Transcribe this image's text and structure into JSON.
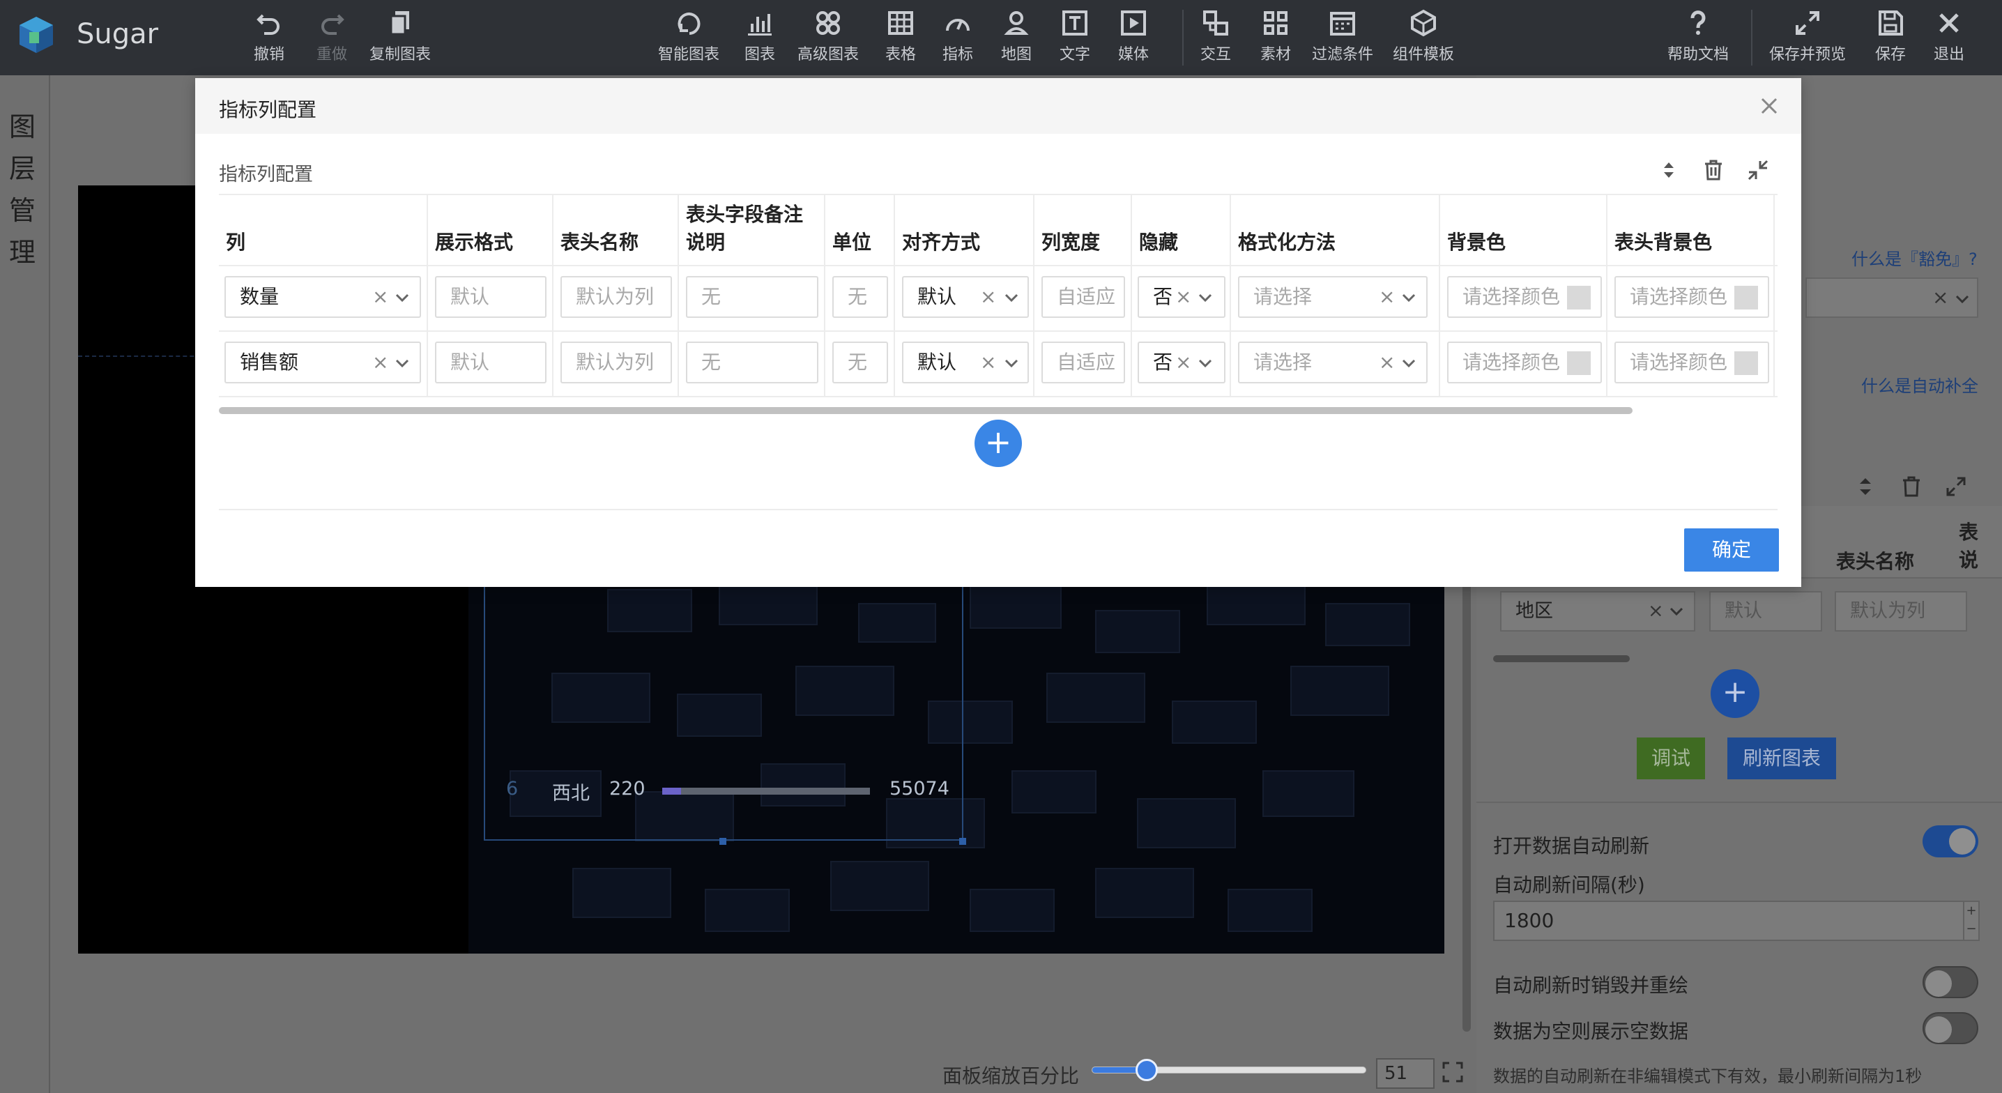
{
  "app": {
    "name": "Sugar"
  },
  "toolbar": {
    "undo": "撤销",
    "redo": "重做",
    "copy_chart": "复制图表",
    "smart_chart": "智能图表",
    "chart": "图表",
    "advanced_chart": "高级图表",
    "table": "表格",
    "indicator": "指标",
    "map": "地图",
    "text": "文字",
    "media": "媒体",
    "interaction": "交互",
    "material": "素材",
    "filter": "过滤条件",
    "component_template": "组件模板",
    "help": "帮助文档",
    "save_preview": "保存并预览",
    "save": "保存",
    "exit": "退出"
  },
  "left_rail": {
    "label": "图层管理"
  },
  "canvas": {
    "rank_row": {
      "index": "6",
      "name": "西北",
      "value": "220",
      "total": "55074",
      "fill_fraction": 0.09
    }
  },
  "zoom": {
    "label": "面板缩放百分比",
    "value": "51",
    "fraction": 0.2
  },
  "right_panel": {
    "link_1": "什么是『豁免』?",
    "link_2": "什么是自动补全",
    "table_headers": [
      "表头名称",
      "表说"
    ],
    "row": {
      "column": "地区",
      "format": "默认",
      "header_name": "默认为列"
    },
    "debug_button": "调试",
    "refresh_button": "刷新图表",
    "auto_refresh_label": "打开数据自动刷新",
    "auto_refresh_on": true,
    "interval_label": "自动刷新间隔(秒)",
    "interval_value": "1800",
    "destroy_redraw_label": "自动刷新时销毁并重绘",
    "destroy_redraw_on": false,
    "empty_data_label": "数据为空则展示空数据",
    "empty_data_on": false,
    "hint": "数据的自动刷新在非编辑模式下有效，最小刷新间隔为1秒",
    "colors": {
      "primary": "#1d4a92",
      "success": "#3f6b22"
    }
  },
  "modal": {
    "title": "指标列配置",
    "section_title": "指标列配置",
    "headers": {
      "column": "列",
      "display_format": "展示格式",
      "header_name": "表头名称",
      "header_note_1": "表头字段备注",
      "header_note_2": "说明",
      "unit": "单位",
      "align": "对齐方式",
      "width": "列宽度",
      "hidden": "隐藏",
      "format_method": "格式化方法",
      "bg_color": "背景色",
      "header_bg_color": "表头背景色"
    },
    "rows": [
      {
        "column": "数量",
        "display_format": "默认",
        "header_name": "默认为列",
        "header_note": "无",
        "unit": "无",
        "align": "默认",
        "width": "自适应",
        "hidden": "否",
        "format_method": "请选择",
        "bg_color": "请选择颜色",
        "header_bg_color": "请选择颜色"
      },
      {
        "column": "销售额",
        "display_format": "默认",
        "header_name": "默认为列",
        "header_note": "无",
        "unit": "无",
        "align": "默认",
        "width": "自适应",
        "hidden": "否",
        "format_method": "请选择",
        "bg_color": "请选择颜色",
        "header_bg_color": "请选择颜色"
      }
    ],
    "add_symbol": "+",
    "confirm": "确定",
    "accent": "#3a86e6"
  }
}
